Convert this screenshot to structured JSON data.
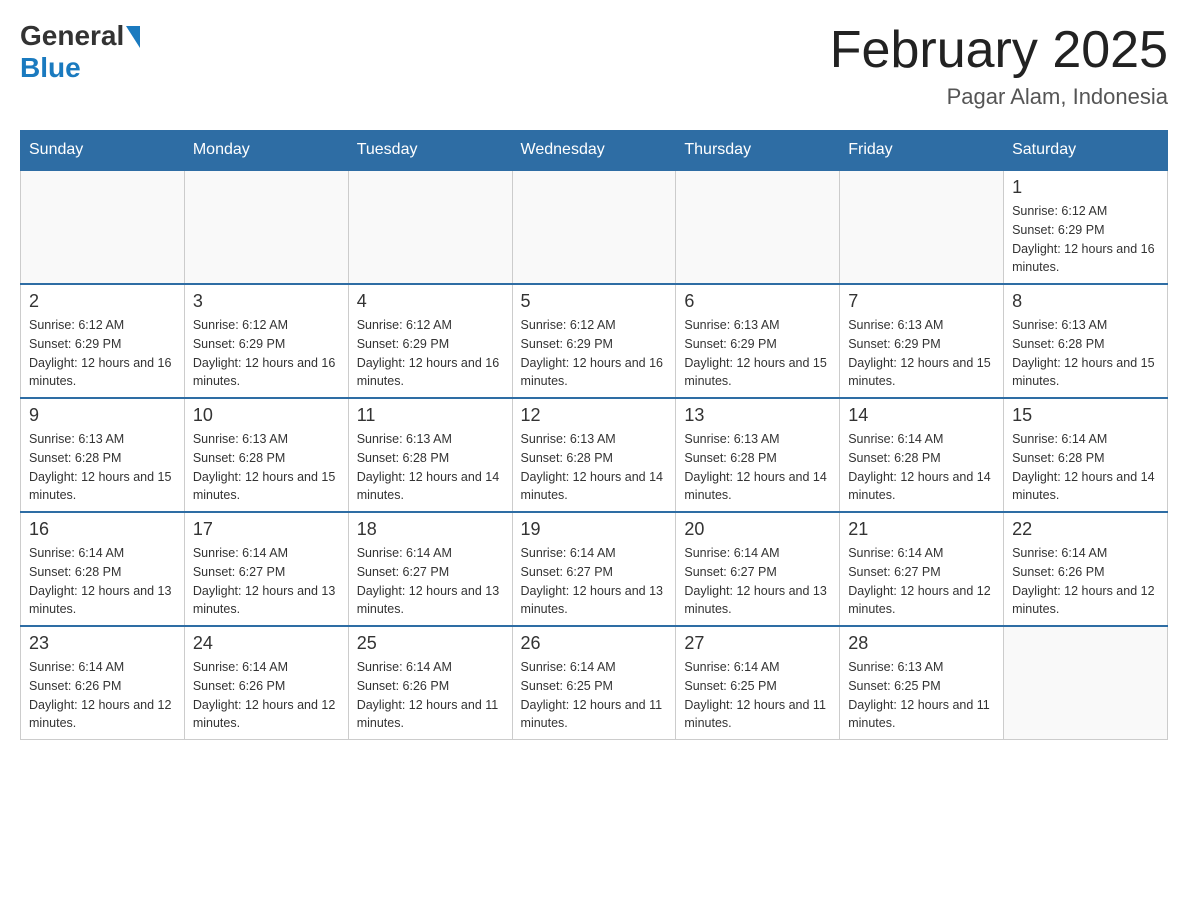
{
  "header": {
    "logo_general": "General",
    "logo_blue": "Blue",
    "month_title": "February 2025",
    "location": "Pagar Alam, Indonesia"
  },
  "days_of_week": [
    "Sunday",
    "Monday",
    "Tuesday",
    "Wednesday",
    "Thursday",
    "Friday",
    "Saturday"
  ],
  "weeks": [
    [
      {
        "day": "",
        "info": ""
      },
      {
        "day": "",
        "info": ""
      },
      {
        "day": "",
        "info": ""
      },
      {
        "day": "",
        "info": ""
      },
      {
        "day": "",
        "info": ""
      },
      {
        "day": "",
        "info": ""
      },
      {
        "day": "1",
        "info": "Sunrise: 6:12 AM\nSunset: 6:29 PM\nDaylight: 12 hours and 16 minutes."
      }
    ],
    [
      {
        "day": "2",
        "info": "Sunrise: 6:12 AM\nSunset: 6:29 PM\nDaylight: 12 hours and 16 minutes."
      },
      {
        "day": "3",
        "info": "Sunrise: 6:12 AM\nSunset: 6:29 PM\nDaylight: 12 hours and 16 minutes."
      },
      {
        "day": "4",
        "info": "Sunrise: 6:12 AM\nSunset: 6:29 PM\nDaylight: 12 hours and 16 minutes."
      },
      {
        "day": "5",
        "info": "Sunrise: 6:12 AM\nSunset: 6:29 PM\nDaylight: 12 hours and 16 minutes."
      },
      {
        "day": "6",
        "info": "Sunrise: 6:13 AM\nSunset: 6:29 PM\nDaylight: 12 hours and 15 minutes."
      },
      {
        "day": "7",
        "info": "Sunrise: 6:13 AM\nSunset: 6:29 PM\nDaylight: 12 hours and 15 minutes."
      },
      {
        "day": "8",
        "info": "Sunrise: 6:13 AM\nSunset: 6:28 PM\nDaylight: 12 hours and 15 minutes."
      }
    ],
    [
      {
        "day": "9",
        "info": "Sunrise: 6:13 AM\nSunset: 6:28 PM\nDaylight: 12 hours and 15 minutes."
      },
      {
        "day": "10",
        "info": "Sunrise: 6:13 AM\nSunset: 6:28 PM\nDaylight: 12 hours and 15 minutes."
      },
      {
        "day": "11",
        "info": "Sunrise: 6:13 AM\nSunset: 6:28 PM\nDaylight: 12 hours and 14 minutes."
      },
      {
        "day": "12",
        "info": "Sunrise: 6:13 AM\nSunset: 6:28 PM\nDaylight: 12 hours and 14 minutes."
      },
      {
        "day": "13",
        "info": "Sunrise: 6:13 AM\nSunset: 6:28 PM\nDaylight: 12 hours and 14 minutes."
      },
      {
        "day": "14",
        "info": "Sunrise: 6:14 AM\nSunset: 6:28 PM\nDaylight: 12 hours and 14 minutes."
      },
      {
        "day": "15",
        "info": "Sunrise: 6:14 AM\nSunset: 6:28 PM\nDaylight: 12 hours and 14 minutes."
      }
    ],
    [
      {
        "day": "16",
        "info": "Sunrise: 6:14 AM\nSunset: 6:28 PM\nDaylight: 12 hours and 13 minutes."
      },
      {
        "day": "17",
        "info": "Sunrise: 6:14 AM\nSunset: 6:27 PM\nDaylight: 12 hours and 13 minutes."
      },
      {
        "day": "18",
        "info": "Sunrise: 6:14 AM\nSunset: 6:27 PM\nDaylight: 12 hours and 13 minutes."
      },
      {
        "day": "19",
        "info": "Sunrise: 6:14 AM\nSunset: 6:27 PM\nDaylight: 12 hours and 13 minutes."
      },
      {
        "day": "20",
        "info": "Sunrise: 6:14 AM\nSunset: 6:27 PM\nDaylight: 12 hours and 13 minutes."
      },
      {
        "day": "21",
        "info": "Sunrise: 6:14 AM\nSunset: 6:27 PM\nDaylight: 12 hours and 12 minutes."
      },
      {
        "day": "22",
        "info": "Sunrise: 6:14 AM\nSunset: 6:26 PM\nDaylight: 12 hours and 12 minutes."
      }
    ],
    [
      {
        "day": "23",
        "info": "Sunrise: 6:14 AM\nSunset: 6:26 PM\nDaylight: 12 hours and 12 minutes."
      },
      {
        "day": "24",
        "info": "Sunrise: 6:14 AM\nSunset: 6:26 PM\nDaylight: 12 hours and 12 minutes."
      },
      {
        "day": "25",
        "info": "Sunrise: 6:14 AM\nSunset: 6:26 PM\nDaylight: 12 hours and 11 minutes."
      },
      {
        "day": "26",
        "info": "Sunrise: 6:14 AM\nSunset: 6:25 PM\nDaylight: 12 hours and 11 minutes."
      },
      {
        "day": "27",
        "info": "Sunrise: 6:14 AM\nSunset: 6:25 PM\nDaylight: 12 hours and 11 minutes."
      },
      {
        "day": "28",
        "info": "Sunrise: 6:13 AM\nSunset: 6:25 PM\nDaylight: 12 hours and 11 minutes."
      },
      {
        "day": "",
        "info": ""
      }
    ]
  ]
}
